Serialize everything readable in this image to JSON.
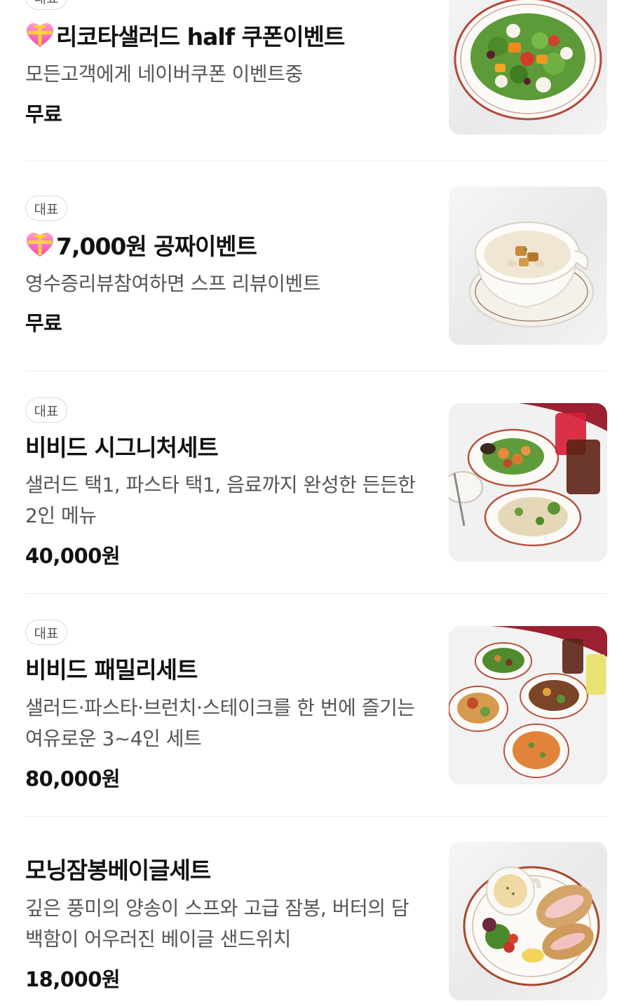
{
  "menu_items": [
    {
      "badge": "대표",
      "title": "리코타샐러드 half 쿠폰이벤트",
      "title_icon": "gift-heart-icon",
      "description": "모든고객에게 네이버쿠폰 이벤트중",
      "price": "무료",
      "image": "salad-plate-photo"
    },
    {
      "badge": "대표",
      "title": "7,000원 공짜이벤트",
      "title_icon": "gift-heart-icon",
      "description": "영수증리뷰참여하면 스프 리뷰이벤트",
      "price": "무료",
      "image": "soup-bowl-photo"
    },
    {
      "badge": "대표",
      "title": "비비드 시그니처세트",
      "description": "샐러드 택1, 파스타 택1, 음료까지 완성한 든든한 2인 메뉴",
      "price": "40,000원",
      "image": "signature-set-photo"
    },
    {
      "badge": "대표",
      "title": "비비드 패밀리세트",
      "description": "샐러드·파스타·브런치·스테이크를 한 번에 즐기는 여유로운 3~4인 세트",
      "price": "80,000원",
      "image": "family-set-photo"
    },
    {
      "title": "모닝잠봉베이글세트",
      "description": "깊은 풍미의 양송이 스프와 고급 잠봉, 버터의 담백함이 어우러진 베이글 샌드위치",
      "price": "18,000원",
      "image": "bagel-set-photo"
    }
  ]
}
